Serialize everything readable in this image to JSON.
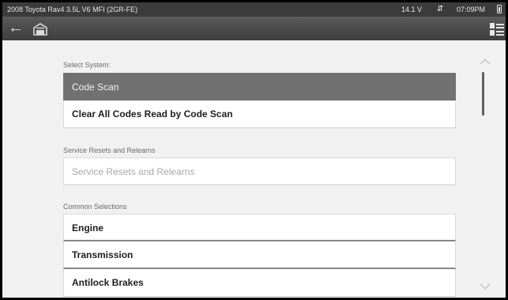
{
  "status_bar": {
    "vehicle": "2008 Toyota Rav4 3.5L V6 MFI (2GR-FE)",
    "voltage": "14.1 V",
    "time": "07:09PM",
    "connection_icon": "link-icon",
    "battery_icon": "battery-icon"
  },
  "toolbar": {
    "back_icon": "back-arrow-icon",
    "home_icon": "home-icon",
    "menu_icon": "list-menu-icon"
  },
  "sections": {
    "select_system": {
      "label": "Select System:",
      "items": [
        "Code Scan",
        "Clear All Codes Read by Code Scan"
      ],
      "selected_index": 0
    },
    "service_resets": {
      "label": "Service Resets and Relearns",
      "items": [
        "Service Resets and Relearns"
      ]
    },
    "common_selections": {
      "label": "Common Selections",
      "items": [
        "Engine",
        "Transmission",
        "Antilock Brakes"
      ]
    }
  },
  "colors": {
    "background": "#f1f1f1",
    "selected_item": "#717171",
    "toolbar": "#4a4a4a",
    "status_bar": "#3b3b3b"
  }
}
